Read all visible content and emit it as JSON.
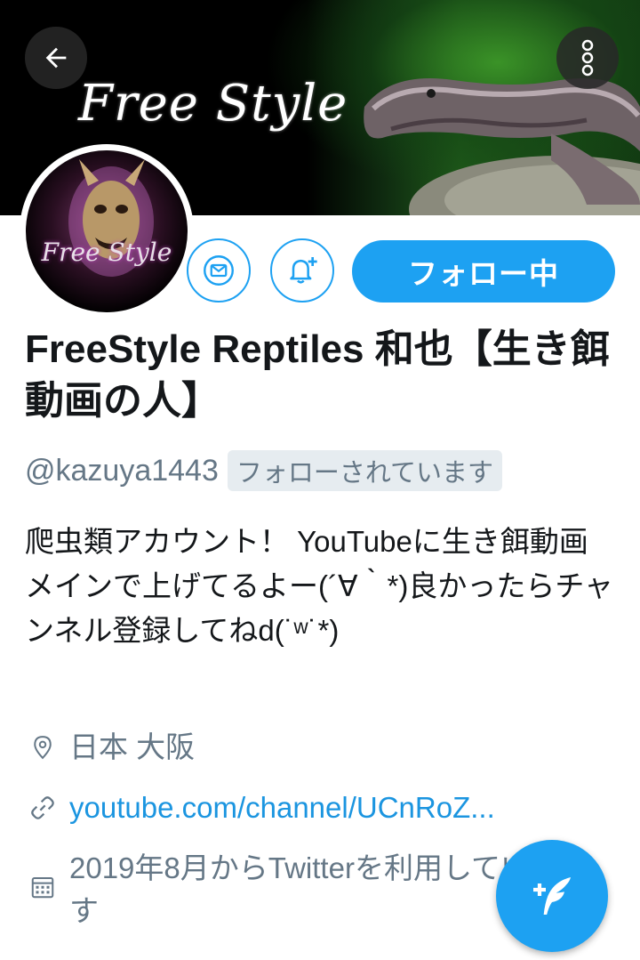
{
  "header": {
    "banner_logo_text": "Free Style",
    "back_icon": "arrow-left-icon",
    "more_icon": "more-vertical-icon"
  },
  "profile": {
    "avatar_text": "Free Style",
    "display_name": "FreeStyle Reptiles 和也【生き餌動画の人】",
    "handle": "@kazuya1443",
    "follows_you": "フォローされています",
    "bio": "爬虫類アカウント！ YouTubeに生き餌動画メインで上げてるよー(´∀｀*)良かったらチャンネル登録してねd(˙ʷ˙*)",
    "location": "日本 大阪",
    "link": "youtube.com/channel/UCnRoZ...",
    "joined": "2019年8月からTwitterを利用しています"
  },
  "actions": {
    "mail_icon": "mail-icon",
    "notify_icon": "bell-plus-icon",
    "follow_label": "フォロー中",
    "compose_icon": "compose-feather-icon"
  },
  "colors": {
    "accent": "#1da1f2",
    "link": "#1b95e0",
    "secondary_text": "#657786"
  }
}
